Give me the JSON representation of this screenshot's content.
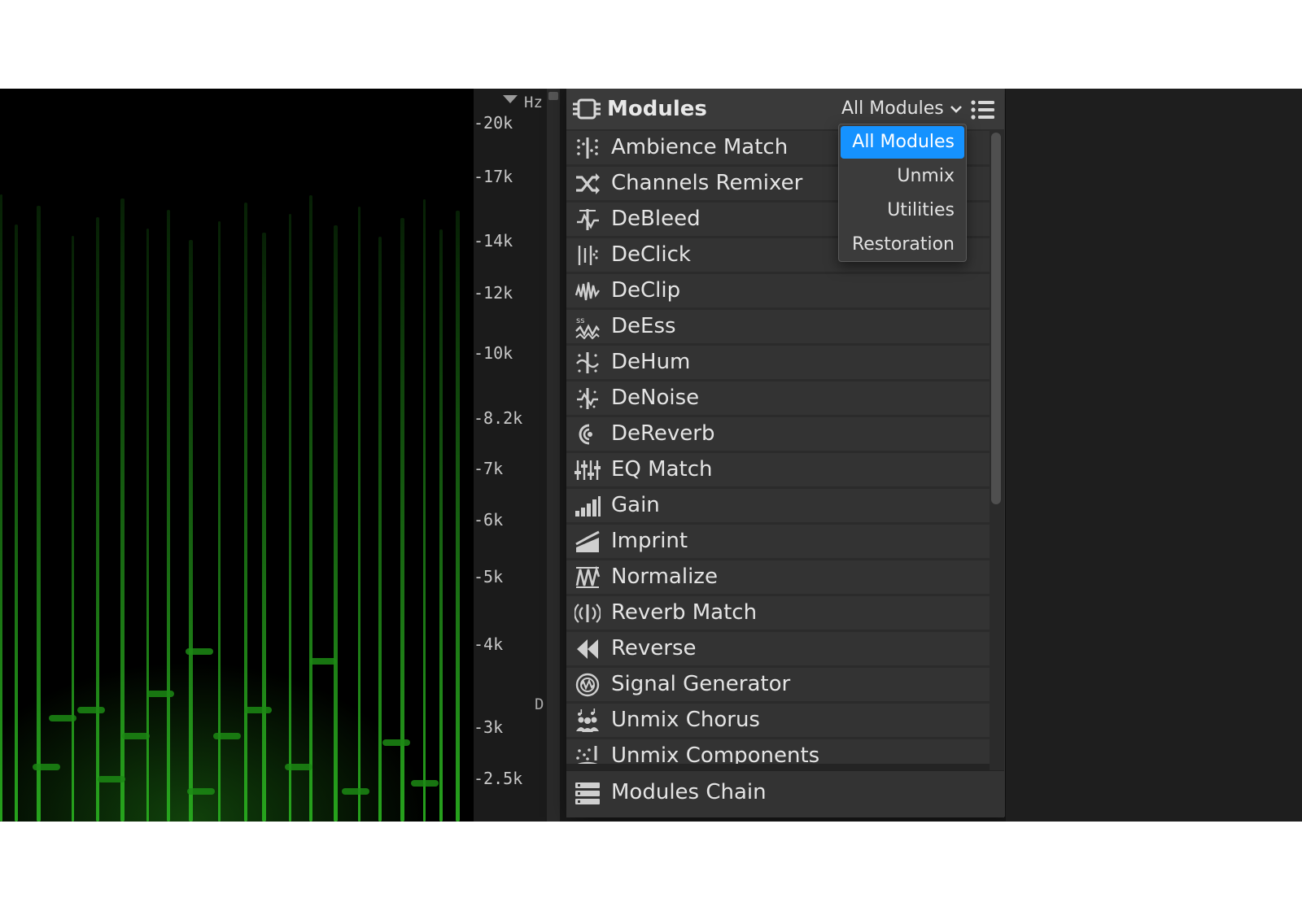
{
  "frequency_scale": {
    "unit": "Hz",
    "ticks": [
      "-20k",
      "-17k",
      "-14k",
      "-12k",
      "-10k",
      "-8.2k",
      "-7k",
      "-6k",
      "-5k",
      "-4k",
      "-3k",
      "-2.5k"
    ],
    "marker": "D"
  },
  "modules_panel": {
    "title": "Modules",
    "header_icon": "modules-icon",
    "filter": {
      "selected": "All Modules",
      "options": [
        "All Modules",
        "Unmix",
        "Utilities",
        "Restoration"
      ]
    },
    "list_view_icon": "list-icon",
    "items": [
      {
        "label": "Ambience Match",
        "icon": "ambience-match-icon"
      },
      {
        "label": "Channels Remixer",
        "icon": "shuffle-icon"
      },
      {
        "label": "DeBleed",
        "icon": "debleed-icon"
      },
      {
        "label": "DeClick",
        "icon": "declick-icon"
      },
      {
        "label": "DeClip",
        "icon": "declip-icon"
      },
      {
        "label": "DeEss",
        "icon": "deess-icon"
      },
      {
        "label": "DeHum",
        "icon": "dehum-icon"
      },
      {
        "label": "DeNoise",
        "icon": "denoise-icon"
      },
      {
        "label": "DeReverb",
        "icon": "dereverb-icon"
      },
      {
        "label": "EQ Match",
        "icon": "eq-match-icon"
      },
      {
        "label": "Gain",
        "icon": "gain-icon"
      },
      {
        "label": "Imprint",
        "icon": "imprint-icon"
      },
      {
        "label": "Normalize",
        "icon": "normalize-icon"
      },
      {
        "label": "Reverb Match",
        "icon": "reverb-match-icon"
      },
      {
        "label": "Reverse",
        "icon": "reverse-icon"
      },
      {
        "label": "Signal Generator",
        "icon": "signal-generator-icon"
      },
      {
        "label": "Unmix Chorus",
        "icon": "unmix-chorus-icon"
      },
      {
        "label": "Unmix Components",
        "icon": "unmix-components-icon"
      }
    ],
    "chain": {
      "label": "Modules Chain",
      "icon": "modules-chain-icon"
    }
  },
  "colors": {
    "accent": "#1592ff",
    "panel_bg": "#2b2b2b",
    "item_bg": "#333333",
    "spectrogram_green": "#1fa51a"
  }
}
